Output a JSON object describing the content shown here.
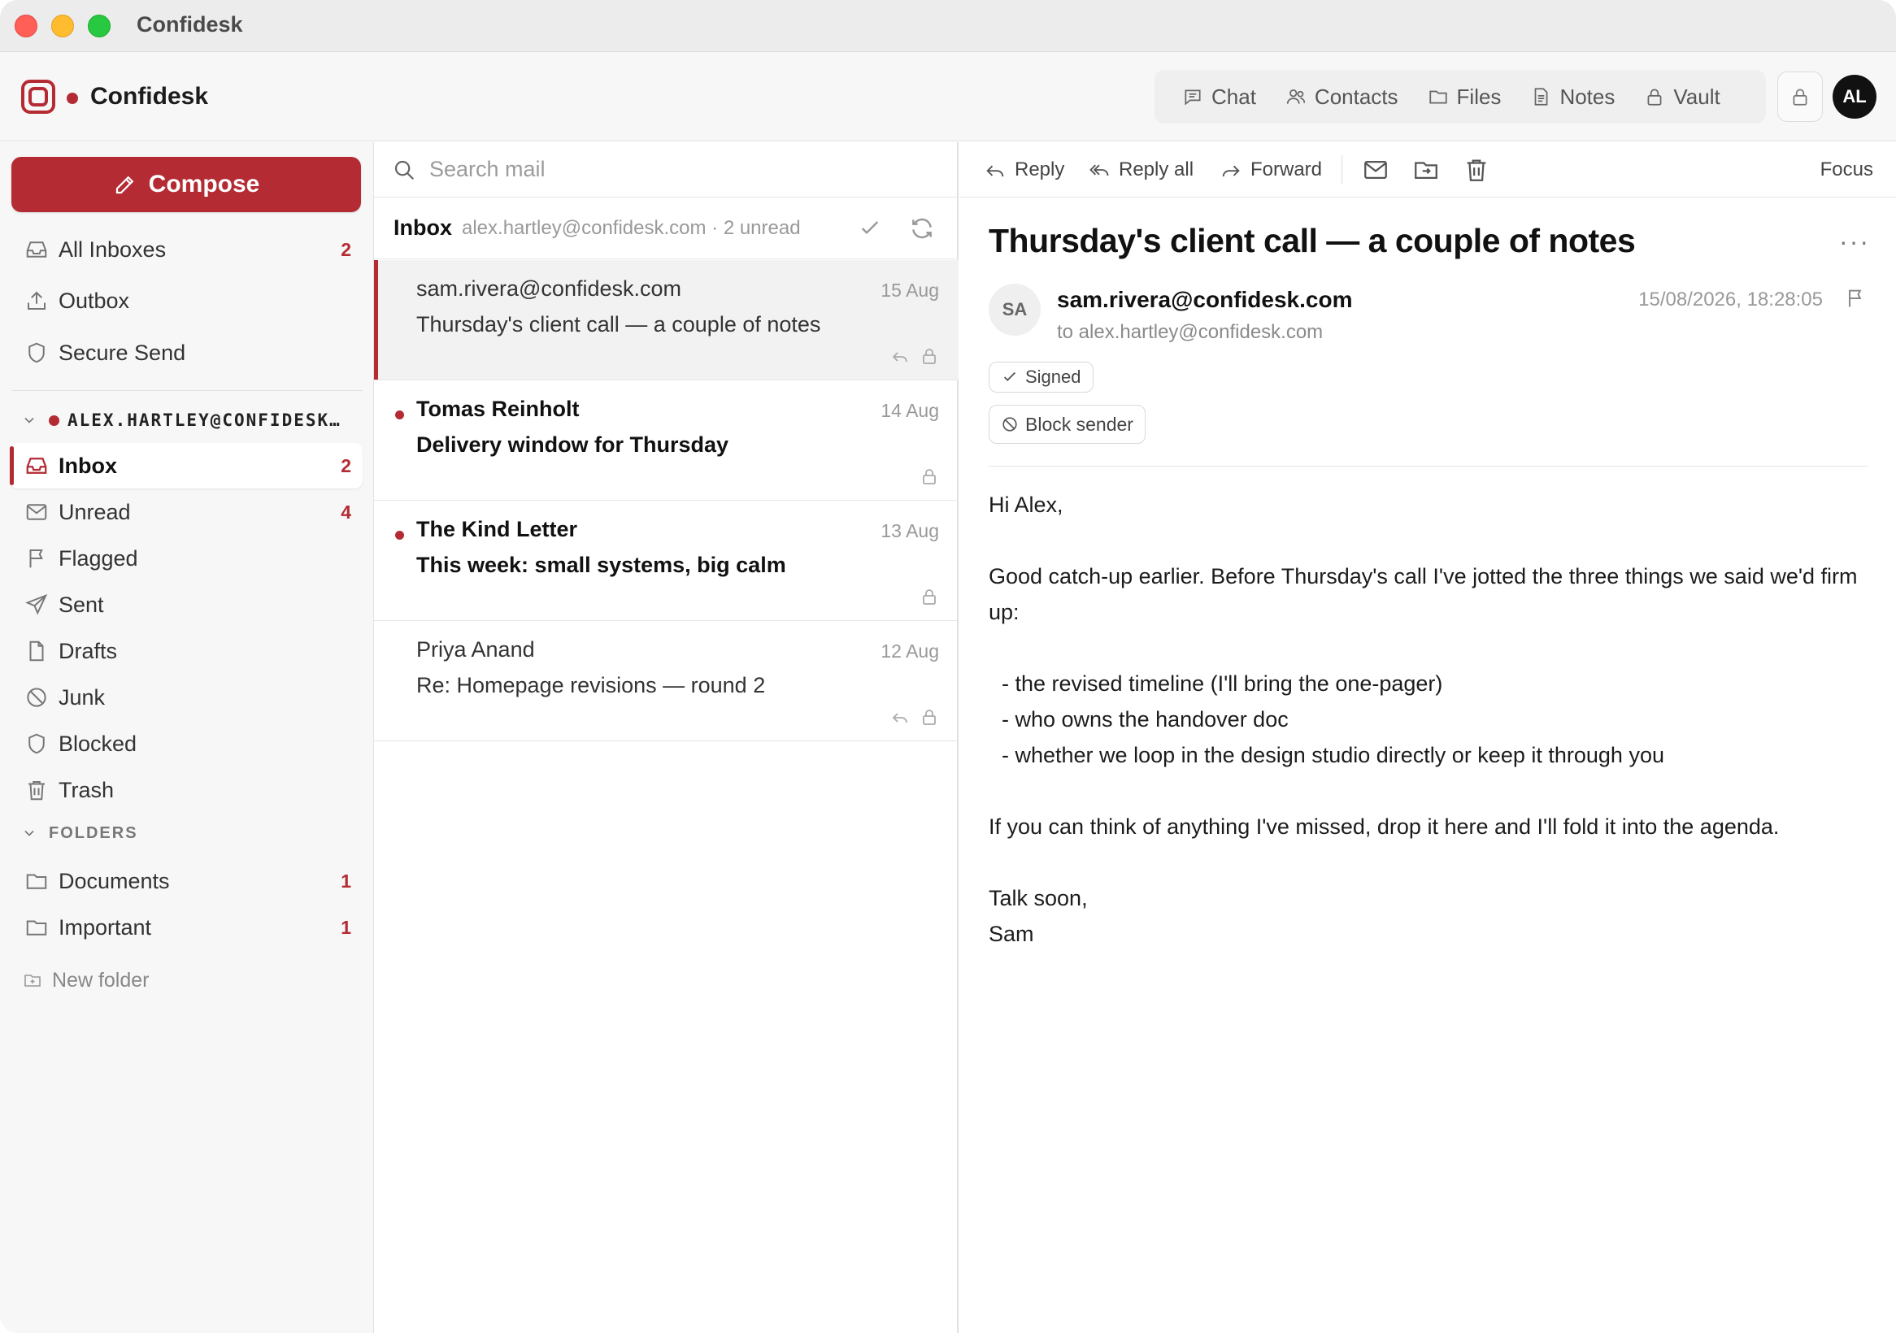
{
  "window": {
    "title": "Confidesk"
  },
  "header": {
    "brand": "Confidesk",
    "nav": [
      {
        "label": "Chat",
        "icon": "chat-icon"
      },
      {
        "label": "Contacts",
        "icon": "contacts-icon"
      },
      {
        "label": "Files",
        "icon": "folder-icon"
      },
      {
        "label": "Notes",
        "icon": "notes-icon"
      },
      {
        "label": "Vault",
        "icon": "lock-icon"
      }
    ],
    "avatar": "AL"
  },
  "sidebar": {
    "compose_label": "Compose",
    "top_items": [
      {
        "label": "All Inboxes",
        "count": "2",
        "icon": "inbox-icon"
      },
      {
        "label": "Outbox",
        "count": "",
        "icon": "upload-icon"
      },
      {
        "label": "Secure Send",
        "count": "",
        "icon": "shield-icon"
      }
    ],
    "account": "ALEX.HARTLEY@CONFIDESK…",
    "mailbox_items": [
      {
        "label": "Inbox",
        "count": "2",
        "icon": "inbox-icon",
        "active": true
      },
      {
        "label": "Unread",
        "count": "4",
        "icon": "envelope-icon"
      },
      {
        "label": "Flagged",
        "count": "",
        "icon": "flag-icon"
      },
      {
        "label": "Sent",
        "count": "",
        "icon": "send-icon"
      },
      {
        "label": "Drafts",
        "count": "",
        "icon": "file-icon"
      },
      {
        "label": "Junk",
        "count": "",
        "icon": "ban-icon"
      },
      {
        "label": "Blocked",
        "count": "",
        "icon": "shield-icon"
      },
      {
        "label": "Trash",
        "count": "",
        "icon": "trash-icon"
      }
    ],
    "folders_heading": "FOLDERS",
    "folders": [
      {
        "label": "Documents",
        "count": "1",
        "icon": "folder-icon"
      },
      {
        "label": "Important",
        "count": "1",
        "icon": "folder-icon"
      }
    ],
    "new_folder_label": "New folder"
  },
  "list": {
    "search_placeholder": "Search mail",
    "header_label": "Inbox",
    "header_meta": "alex.hartley@confidesk.com · 2 unread",
    "messages": [
      {
        "from": "sam.rivera@confidesk.com",
        "subject": "Thursday's client call — a couple of notes",
        "date": "15 Aug",
        "unread": false,
        "selected": true,
        "replied": true
      },
      {
        "from": "Tomas Reinholt",
        "subject": "Delivery window for Thursday",
        "date": "14 Aug",
        "unread": true,
        "selected": false,
        "replied": false
      },
      {
        "from": "The Kind Letter",
        "subject": "This week: small systems, big calm",
        "date": "13 Aug",
        "unread": true,
        "selected": false,
        "replied": false
      },
      {
        "from": "Priya Anand",
        "subject": "Re: Homepage revisions — round 2",
        "date": "12 Aug",
        "unread": false,
        "selected": false,
        "replied": true
      }
    ]
  },
  "reader": {
    "toolbar": {
      "reply": "Reply",
      "reply_all": "Reply all",
      "forward": "Forward",
      "focus": "Focus"
    },
    "title": "Thursday's client call — a couple of notes",
    "sender_initials": "SA",
    "sender": "sam.rivera@confidesk.com",
    "to": "to alex.hartley@confidesk.com",
    "timestamp": "15/08/2026, 18:28:05",
    "signed_label": "Signed",
    "block_label": "Block sender",
    "body": [
      "Hi Alex,",
      "",
      "Good catch-up earlier. Before Thursday's call I've jotted the three things we said we'd firm up:",
      "",
      "  - the revised timeline (I'll bring the one-pager)",
      "  - who owns the handover doc",
      "  - whether we loop in the design studio directly or keep it through you",
      "",
      "If you can think of anything I've missed, drop it here and I'll fold it into the agenda.",
      "",
      "Talk soon,",
      "Sam"
    ]
  },
  "colors": {
    "accent": "#b42b34",
    "muted": "#999999"
  }
}
